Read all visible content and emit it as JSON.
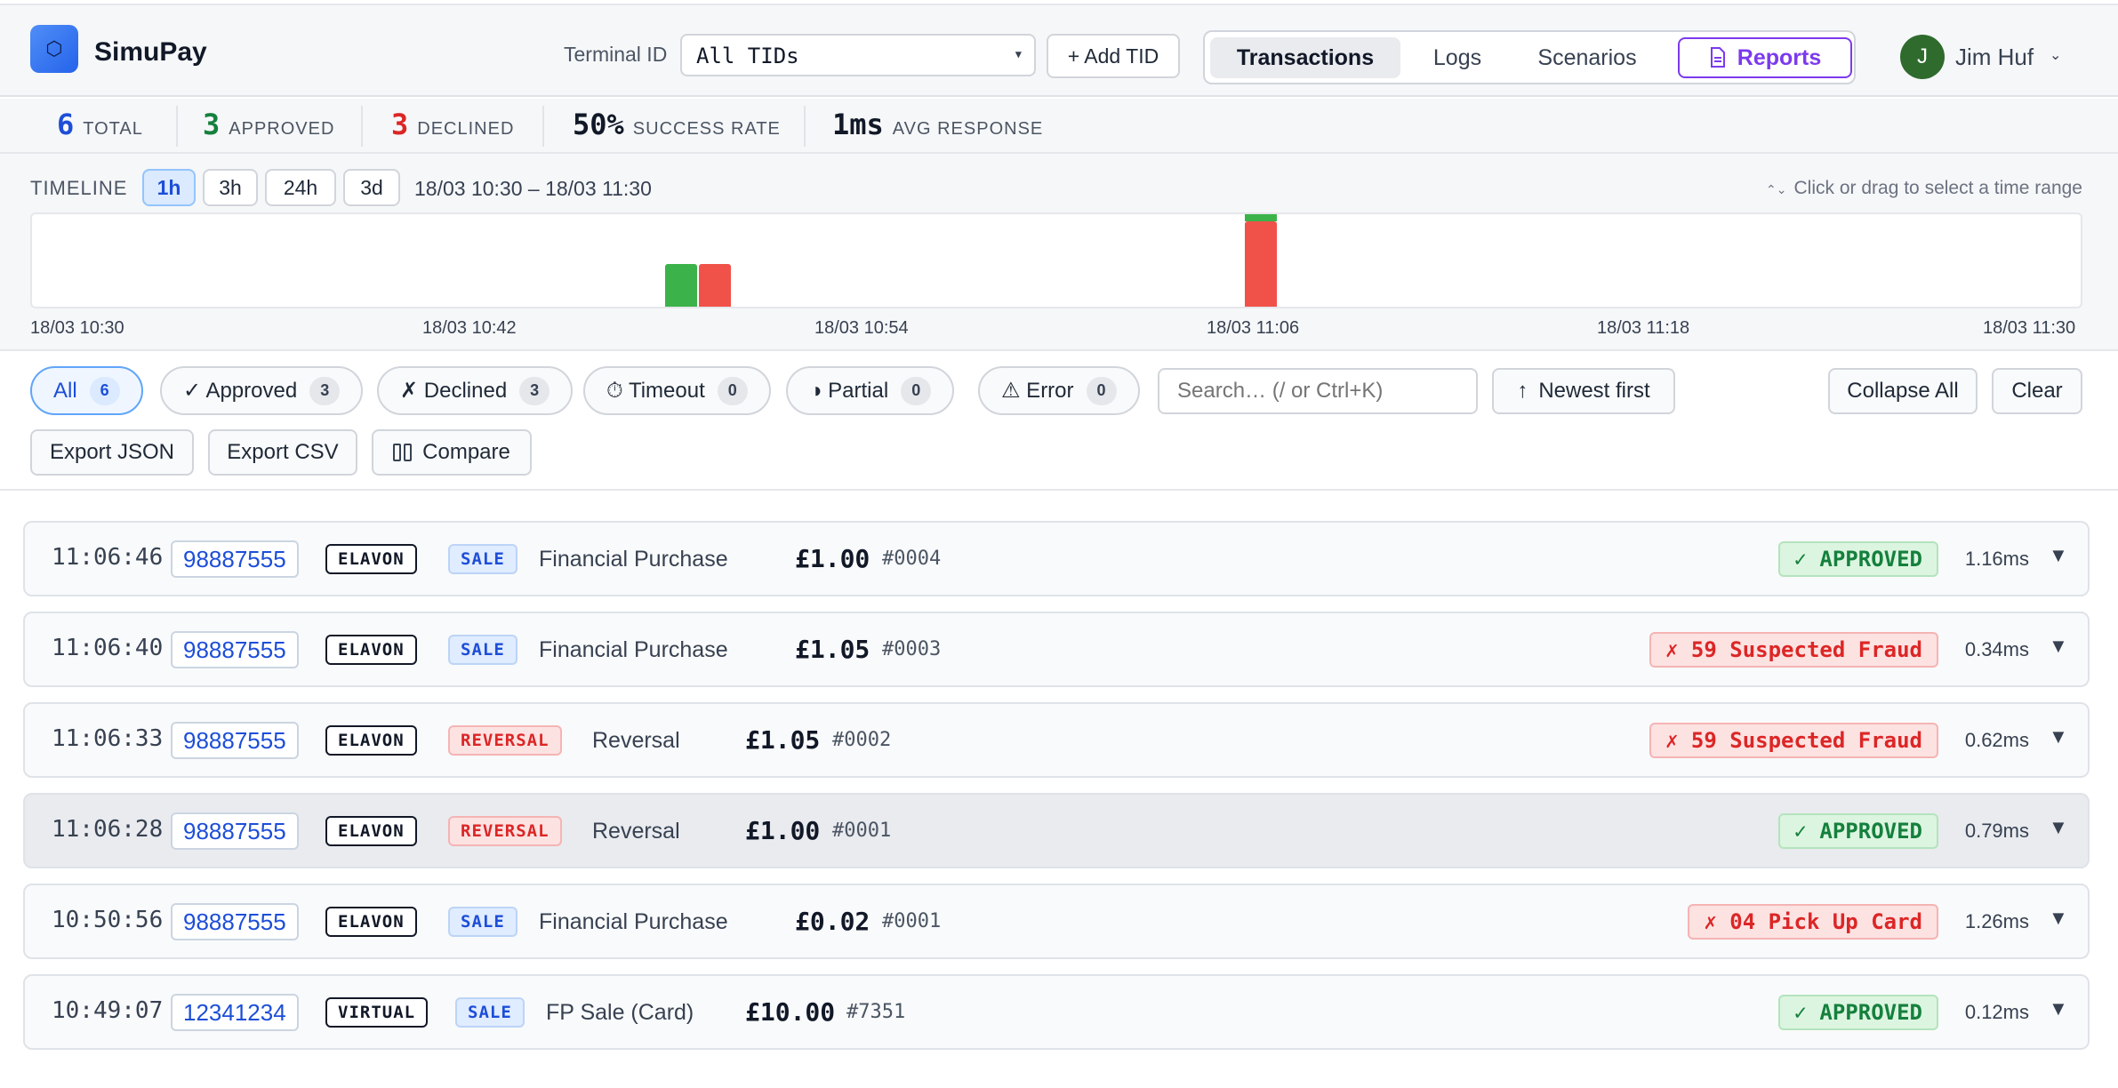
{
  "app": {
    "name": "SimuPay",
    "logo_icon": "hexagon-icon"
  },
  "terminal": {
    "label": "Terminal ID",
    "selected": "All TIDs",
    "add_label": "+ Add TID"
  },
  "nav": {
    "transactions": "Transactions",
    "logs": "Logs",
    "scenarios": "Scenarios",
    "reports": "Reports"
  },
  "user": {
    "initial": "J",
    "name": "Jim Huf"
  },
  "stats": {
    "total": {
      "value": "6",
      "label": "TOTAL"
    },
    "approved": {
      "value": "3",
      "label": "APPROVED"
    },
    "declined": {
      "value": "3",
      "label": "DECLINED"
    },
    "success": {
      "value": "50%",
      "label": "SUCCESS RATE"
    },
    "avg": {
      "value": "1ms",
      "label": "AVG RESPONSE"
    }
  },
  "colors": {
    "approved": "#3cb34a",
    "declined": "#f0524a",
    "accent": "#2563eb",
    "reports": "#7c3aed"
  },
  "timeline": {
    "label": "TIMELINE",
    "ranges": [
      "1h",
      "3h",
      "24h",
      "3d"
    ],
    "active_range": "1h",
    "window": "18/03 10:30 – 18/03 11:30",
    "hint": "Click or drag to select a time range",
    "axis": [
      "18/03 10:30",
      "18/03 10:42",
      "18/03 10:54",
      "18/03 11:06",
      "18/03 11:18",
      "18/03 11:30"
    ],
    "buckets": [
      {
        "time": "10:49",
        "approved": 1,
        "declined": 0
      },
      {
        "time": "10:50",
        "approved": 0,
        "declined": 1
      },
      {
        "time": "11:06",
        "approved": 2,
        "declined": 2
      }
    ]
  },
  "filters": {
    "all": {
      "label": "All",
      "count": "6"
    },
    "approved": {
      "label": "✓ Approved",
      "count": "3"
    },
    "declined": {
      "label": "✗ Declined",
      "count": "3"
    },
    "timeout": {
      "label": "⏱ Timeout",
      "count": "0"
    },
    "partial": {
      "label": "◑ Partial",
      "count": "0"
    },
    "error": {
      "label": "⚠ Error",
      "count": "0"
    },
    "search_placeholder": "Search… (/ or Ctrl+K)",
    "sort_label": "Newest first",
    "collapse_label": "Collapse All",
    "clear_label": "Clear",
    "export_json": "Export JSON",
    "export_csv": "Export CSV",
    "compare": "Compare"
  },
  "transactions": [
    {
      "time": "11:06:46",
      "tid": "98887555",
      "processor": "ELAVON",
      "type": "SALE",
      "desc": "Financial Purchase",
      "amount": "£1.00",
      "ref": "#0004",
      "status": "✓ APPROVED",
      "ms": "1.16ms"
    },
    {
      "time": "11:06:40",
      "tid": "98887555",
      "processor": "ELAVON",
      "type": "SALE",
      "desc": "Financial Purchase",
      "amount": "£1.05",
      "ref": "#0003",
      "status": "✗ 59 Suspected Fraud",
      "ms": "0.34ms"
    },
    {
      "time": "11:06:33",
      "tid": "98887555",
      "processor": "ELAVON",
      "type": "REVERSAL",
      "desc": "Reversal",
      "amount": "£1.05",
      "ref": "#0002",
      "status": "✗ 59 Suspected Fraud",
      "ms": "0.62ms"
    },
    {
      "time": "11:06:28",
      "tid": "98887555",
      "processor": "ELAVON",
      "type": "REVERSAL",
      "desc": "Reversal",
      "amount": "£1.00",
      "ref": "#0001",
      "status": "✓ APPROVED",
      "ms": "0.79ms"
    },
    {
      "time": "10:50:56",
      "tid": "98887555",
      "processor": "ELAVON",
      "type": "SALE",
      "desc": "Financial Purchase",
      "amount": "£0.02",
      "ref": "#0001",
      "status": "✗ 04 Pick Up Card",
      "ms": "1.26ms"
    },
    {
      "time": "10:49:07",
      "tid": "12341234",
      "processor": "VIRTUAL",
      "type": "SALE",
      "desc": "FP Sale (Card)",
      "amount": "£10.00",
      "ref": "#7351",
      "status": "✓ APPROVED",
      "ms": "0.12ms"
    }
  ]
}
